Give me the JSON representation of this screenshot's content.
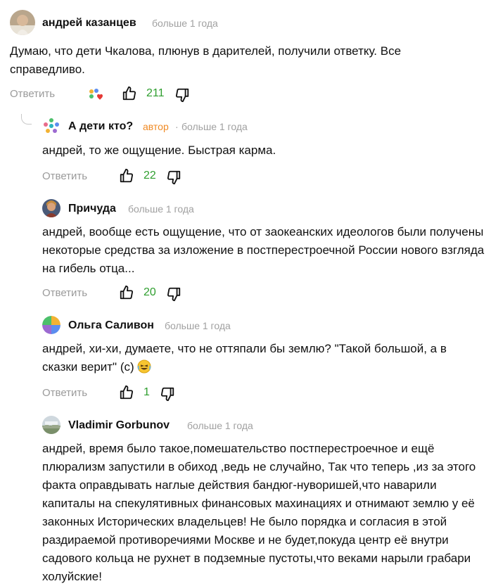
{
  "comments": [
    {
      "author": "андрей казанцев",
      "time": "больше 1 года",
      "text": "Думаю, что дети Чкалова, плюнув в дарителей, получили ответку. Все справедливо.",
      "reply_label": "Ответить",
      "likes": "211",
      "avatar_icon": "user-photo"
    },
    {
      "author": "А дети кто?",
      "author_tag": "автор",
      "separator": "·",
      "time": "больше 1 года",
      "text": "андрей, то же ощущение. Быстрая карма.",
      "reply_label": "Ответить",
      "likes": "22",
      "avatar_icon": "flower-logo"
    },
    {
      "author": "Причуда",
      "time": "больше 1 года",
      "text": "андрей, вообще есть ощущение, что от заокеанских идеологов были получены некоторые средства за изложение в постперестроечной России нового взгляда на гибель отца...",
      "reply_label": "Ответить",
      "likes": "20",
      "avatar_icon": "user-photo"
    },
    {
      "author": "Ольга Саливон",
      "time": "больше 1 года",
      "text": "андрей, хи-хи, думаете, что не оттяпали бы землю? \"Такой большой, а в сказки верит\" (с)",
      "emoji_icon": "laughing-emoji",
      "reply_label": "Ответить",
      "likes": "1",
      "avatar_icon": "pie-avatar"
    },
    {
      "author": "Vladimir Gorbunov",
      "time": "больше 1 года",
      "text": "андрей, время было такое,помешательство постперестроечное и ещё плюрализм запустили в обиход ,ведь не случайно, Так что теперь ,из за этого факта оправдывать наглые действия бандюг-нуворишей,что наварили капиталы на спекулятивных финансовых махинациях и отнимают землю у её законных Исторических владельцев! Не было порядка и согласия в этой раздираемой противоречиями Москве и не будет,покуда центр её внутри садового кольца не рухнет в подземные пустоты,что веками нарыли грабари холуйские!",
      "avatar_icon": "landscape-photo"
    }
  ],
  "colors": {
    "like_count": "#2e9e2e",
    "author_tag": "#f08a24",
    "muted": "#a0a0a0"
  }
}
